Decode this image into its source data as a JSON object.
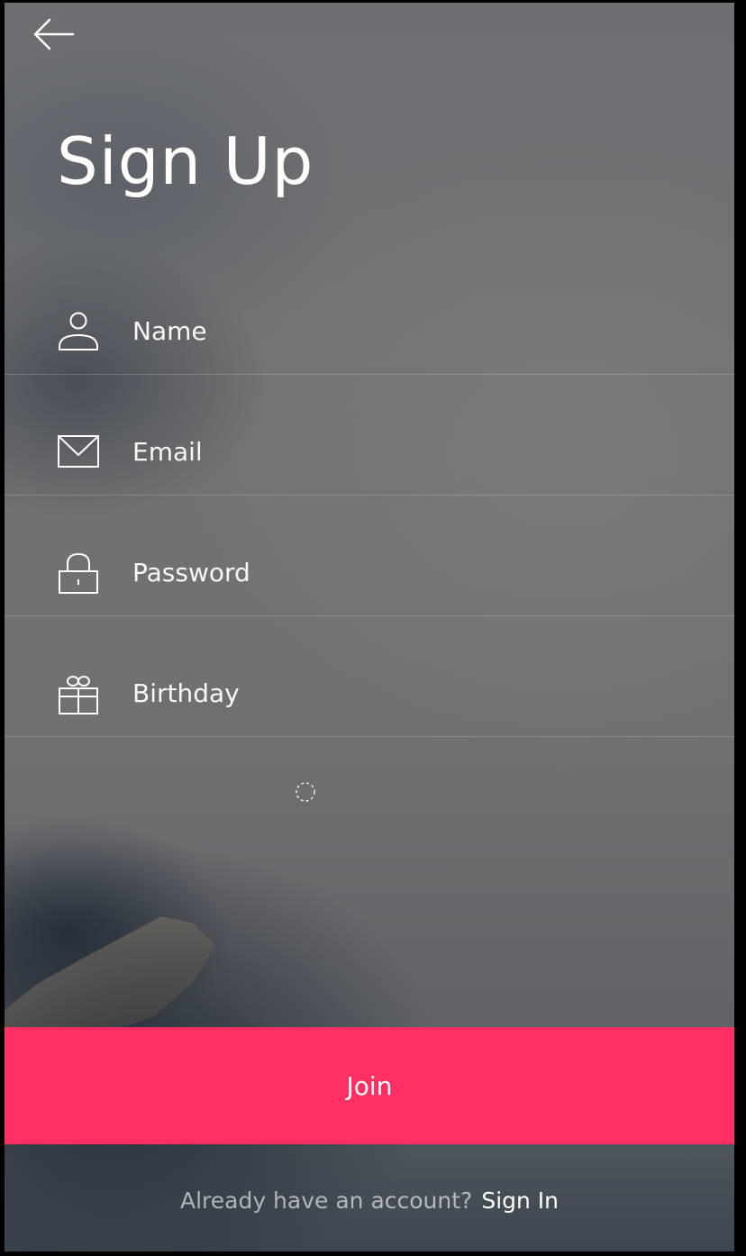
{
  "header": {
    "back_icon": "arrow-left-icon",
    "title": "Sign Up"
  },
  "form": {
    "fields": [
      {
        "placeholder": "Name",
        "icon": "user-icon",
        "value": ""
      },
      {
        "placeholder": "Email",
        "icon": "envelope-icon",
        "value": ""
      },
      {
        "placeholder": "Password",
        "icon": "lock-icon",
        "value": ""
      },
      {
        "placeholder": "Birthday",
        "icon": "gift-icon",
        "value": ""
      }
    ]
  },
  "spinner_icon": "loading-spinner-icon",
  "join_label": "Join",
  "footer": {
    "prompt": "Already have an account?",
    "link": "Sign In"
  },
  "colors": {
    "accent": "#ff2e63",
    "text": "#ffffff"
  }
}
